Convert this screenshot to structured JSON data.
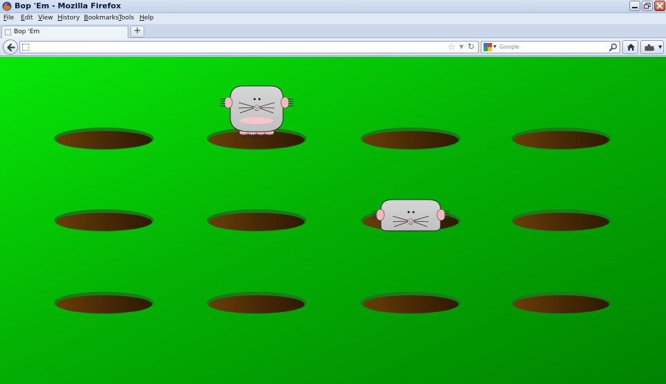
{
  "window": {
    "title": "Bop 'Em - Mozilla Firefox"
  },
  "menu": {
    "items": [
      "File",
      "Edit",
      "View",
      "History",
      "Bookmarks",
      "Tools",
      "Help"
    ]
  },
  "tabs": [
    {
      "label": "Bop 'Em",
      "active": true
    }
  ],
  "new_tab_label": "+",
  "address_bar": {
    "value": ""
  },
  "search_bar": {
    "placeholder": "Google",
    "engine_icon": "google-icon"
  },
  "game": {
    "background_colors": [
      "#07e807",
      "#008300"
    ],
    "hole_color": "#4a2a06",
    "hole_rim_color": "#1a7a1a",
    "mole_color": "#c0c0c0",
    "holes": [
      {
        "row": 1,
        "col": 1,
        "mole": "none"
      },
      {
        "row": 1,
        "col": 2,
        "mole": "full"
      },
      {
        "row": 1,
        "col": 3,
        "mole": "none"
      },
      {
        "row": 1,
        "col": 4,
        "mole": "none"
      },
      {
        "row": 2,
        "col": 1,
        "mole": "none"
      },
      {
        "row": 2,
        "col": 2,
        "mole": "none"
      },
      {
        "row": 2,
        "col": 3,
        "mole": "peeking"
      },
      {
        "row": 2,
        "col": 4,
        "mole": "none"
      },
      {
        "row": 3,
        "col": 1,
        "mole": "none"
      },
      {
        "row": 3,
        "col": 2,
        "mole": "none"
      },
      {
        "row": 3,
        "col": 3,
        "mole": "none"
      },
      {
        "row": 3,
        "col": 4,
        "mole": "none"
      }
    ]
  }
}
